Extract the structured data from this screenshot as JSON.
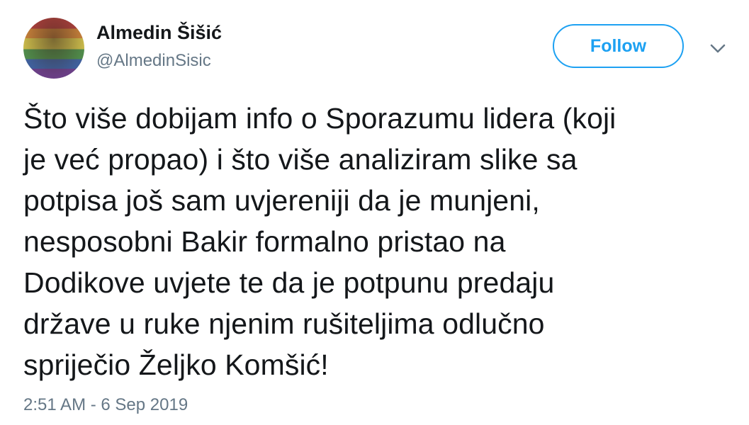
{
  "author": {
    "display_name": "Almedin Šišić",
    "handle": "@AlmedinSisic"
  },
  "actions": {
    "follow_label": "Follow"
  },
  "icons": {
    "avatar": "avatar-image",
    "menu": "chevron-down-icon"
  },
  "tweet": {
    "text": "Što više dobijam info o Sporazumu lidera (koji\nje već propao) i što više analiziram slike sa\npotpisa još sam uvjereniji da je munjeni,\nnesposobni Bakir formalno pristao na\nDodikove uvjete te da je potpunu predaju\ndržave u ruke njenim rušiteljima odlučno\nspriječio Željko Komšić!",
    "timestamp": "2:51 AM - 6 Sep 2019"
  },
  "colors": {
    "accent": "#1da1f2",
    "text_primary": "#14171a",
    "text_secondary": "#657786"
  }
}
